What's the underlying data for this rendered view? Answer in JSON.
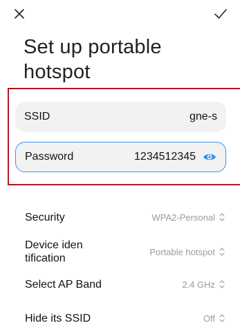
{
  "header": {
    "close_icon": "close-icon",
    "confirm_icon": "check-icon",
    "title": "Set up portable hotspot"
  },
  "fields": {
    "ssid": {
      "label": "SSID",
      "value": "gne-s"
    },
    "password": {
      "label": "Password",
      "value": "1234512345",
      "icon": "eye-icon"
    }
  },
  "settings": [
    {
      "label": "Security",
      "value": "WPA2-Personal"
    },
    {
      "label": "Device iden tification",
      "value": "Portable hotspot"
    },
    {
      "label": "Select AP Band",
      "value": "2.4 GHz"
    },
    {
      "label": "Hide its SSID",
      "value": "Off"
    }
  ],
  "colors": {
    "accent": "#3a8ee8",
    "highlight": "#b3161c",
    "field_bg": "#f2f2f2",
    "muted_text": "#9a9a9a"
  }
}
